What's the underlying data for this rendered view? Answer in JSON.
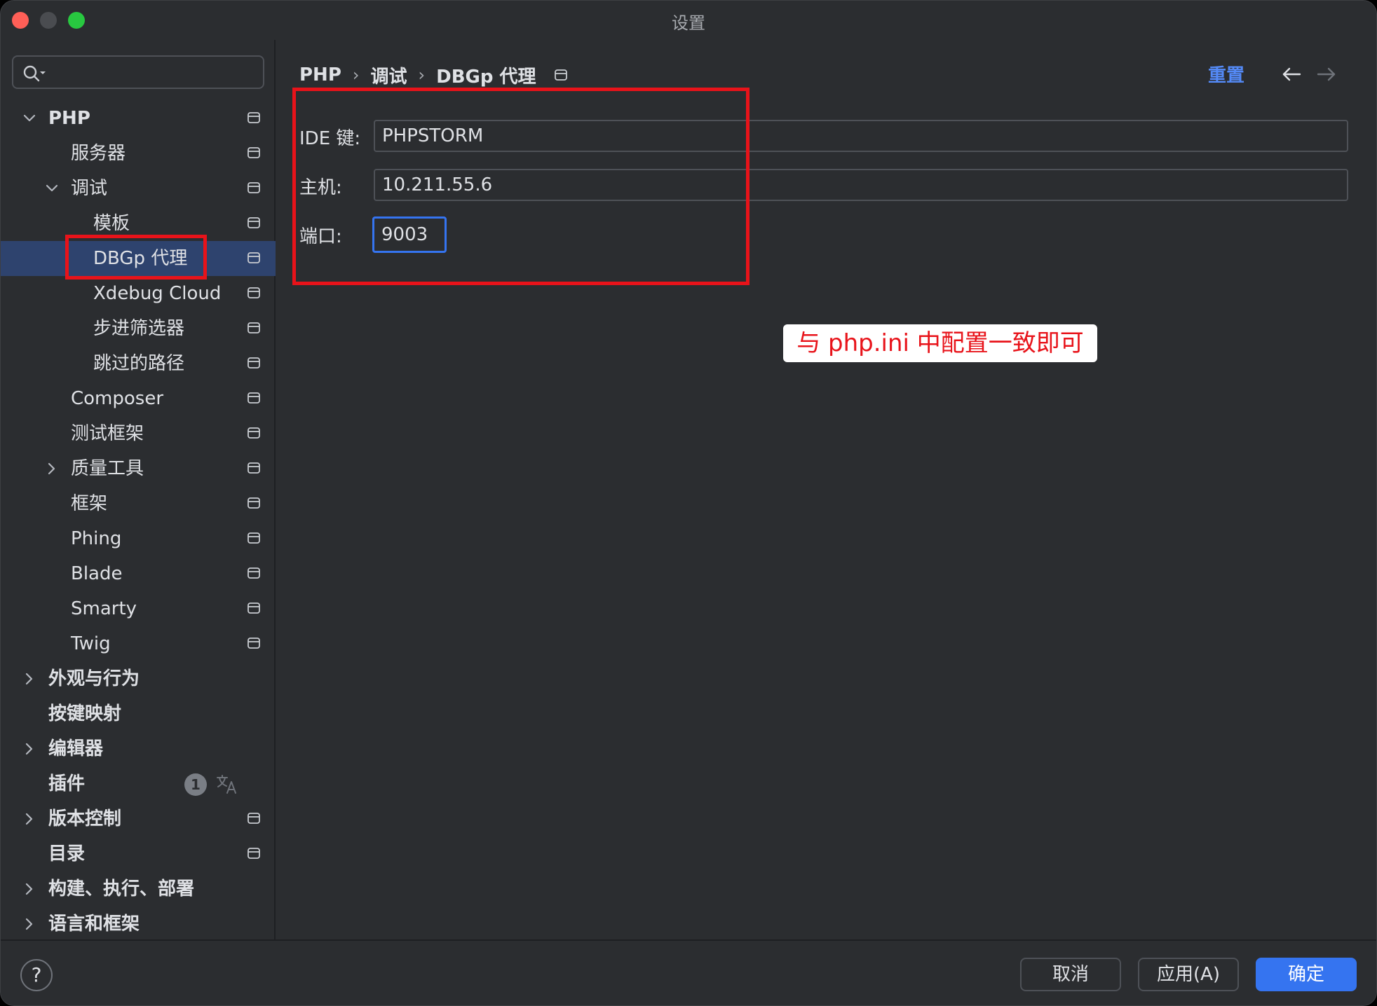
{
  "window": {
    "title": "设置"
  },
  "search": {
    "placeholder": ""
  },
  "sidebar": {
    "items": [
      {
        "label": "PHP",
        "depth": 0,
        "expand": "open",
        "bold": true,
        "page": true
      },
      {
        "label": "服务器",
        "depth": 1,
        "expand": "none",
        "bold": false,
        "page": true
      },
      {
        "label": "调试",
        "depth": 1,
        "expand": "open",
        "bold": false,
        "page": true
      },
      {
        "label": "模板",
        "depth": 2,
        "expand": "none",
        "bold": false,
        "page": true
      },
      {
        "label": "DBGp 代理",
        "depth": 2,
        "expand": "none",
        "bold": false,
        "page": true,
        "selected": true
      },
      {
        "label": "Xdebug Cloud",
        "depth": 2,
        "expand": "none",
        "bold": false,
        "page": true
      },
      {
        "label": "步进筛选器",
        "depth": 2,
        "expand": "none",
        "bold": false,
        "page": true
      },
      {
        "label": "跳过的路径",
        "depth": 2,
        "expand": "none",
        "bold": false,
        "page": true
      },
      {
        "label": "Composer",
        "depth": 1,
        "expand": "none",
        "bold": false,
        "page": true
      },
      {
        "label": "测试框架",
        "depth": 1,
        "expand": "none",
        "bold": false,
        "page": true
      },
      {
        "label": "质量工具",
        "depth": 1,
        "expand": "closed",
        "bold": false,
        "page": true
      },
      {
        "label": "框架",
        "depth": 1,
        "expand": "none",
        "bold": false,
        "page": true
      },
      {
        "label": "Phing",
        "depth": 1,
        "expand": "none",
        "bold": false,
        "page": true
      },
      {
        "label": "Blade",
        "depth": 1,
        "expand": "none",
        "bold": false,
        "page": true
      },
      {
        "label": "Smarty",
        "depth": 1,
        "expand": "none",
        "bold": false,
        "page": true
      },
      {
        "label": "Twig",
        "depth": 1,
        "expand": "none",
        "bold": false,
        "page": true
      },
      {
        "label": "外观与行为",
        "depth": 0,
        "expand": "closed",
        "bold": true,
        "page": false
      },
      {
        "label": "按键映射",
        "depth": 0,
        "expand": "none",
        "bold": true,
        "page": false
      },
      {
        "label": "编辑器",
        "depth": 0,
        "expand": "closed",
        "bold": true,
        "page": false
      },
      {
        "label": "插件",
        "depth": 0,
        "expand": "none",
        "bold": true,
        "page": false,
        "badge": "1",
        "translate": true
      },
      {
        "label": "版本控制",
        "depth": 0,
        "expand": "closed",
        "bold": true,
        "page": true
      },
      {
        "label": "目录",
        "depth": 0,
        "expand": "none",
        "bold": true,
        "page": true
      },
      {
        "label": "构建、执行、部署",
        "depth": 0,
        "expand": "closed",
        "bold": true,
        "page": false
      },
      {
        "label": "语言和框架",
        "depth": 0,
        "expand": "closed",
        "bold": true,
        "page": false
      }
    ]
  },
  "breadcrumb": {
    "part1": "PHP",
    "part2": "调试",
    "part3": "DBGp 代理",
    "separator": "›"
  },
  "header": {
    "reset_label": "重置"
  },
  "form": {
    "ide_key": {
      "label": "IDE 键:",
      "value": "PHPSTORM"
    },
    "host": {
      "label": "主机:",
      "value": "10.211.55.6"
    },
    "port": {
      "label": "端口:",
      "value": "9003"
    }
  },
  "annotation": {
    "note": "与 php.ini 中配置一致即可",
    "color": "#e8131a"
  },
  "footer": {
    "help_label": "?",
    "cancel_label": "取消",
    "apply_label": "应用(A)",
    "ok_label": "确定"
  },
  "colors": {
    "accent": "#3574f0",
    "selection": "#2e436e",
    "link": "#548af7",
    "background": "#2b2d30"
  }
}
